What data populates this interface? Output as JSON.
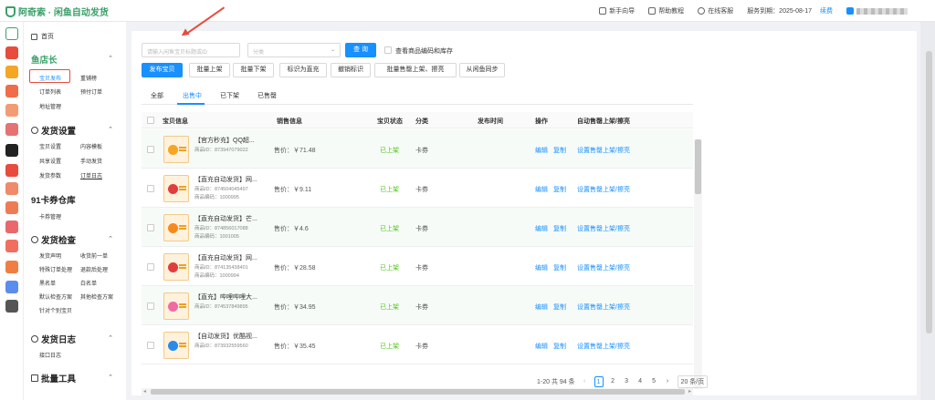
{
  "app": {
    "title": "阿奇索 · 闲鱼自动发货"
  },
  "topbar": {
    "guide": "新手向导",
    "help": "帮助教程",
    "support": "在线客服",
    "service_label": "服务到期：2025-08-17",
    "renew": "续费"
  },
  "sidebar": {
    "home": "首页",
    "sections": [
      {
        "title": "鱼店长",
        "items": [
          "宝贝发布",
          "重铺榜",
          "订单列表",
          "预付订单",
          "地址管理"
        ]
      },
      {
        "title": "发货设置",
        "items": [
          "宝贝设置",
          "内容模板",
          "共享设置",
          "手动发货",
          "发货参数",
          "订单日志"
        ]
      },
      {
        "title": "91卡券仓库",
        "items": [
          "卡券管理"
        ]
      },
      {
        "title": "发货检查",
        "items": [
          "发货声明",
          "收货前一单",
          "特殊订单处理",
          "退款后处理",
          "黑名单",
          "白名单",
          "默认检查方案",
          "其他检查方案",
          "针对个别宝贝"
        ]
      },
      {
        "title": "发货日志",
        "items": [
          "接口日志"
        ]
      },
      {
        "title": "批量工具",
        "items": []
      }
    ]
  },
  "filters": {
    "keyword_placeholder": "请输入闲鱼宝贝标题或ID",
    "category_placeholder": "分类",
    "search_button": "查 询",
    "show_code_label": "查看商品编码和库存"
  },
  "toolbar": {
    "buttons": [
      "发布宝贝",
      "批量上架",
      "批量下架",
      "标识为直充",
      "撤销标识",
      "批量售罄上架、擦亮",
      "从闲鱼同步"
    ]
  },
  "tabs": [
    "全部",
    "出售中",
    "已下架",
    "已售罄"
  ],
  "table": {
    "headers": [
      "宝贝信息",
      "销售信息",
      "宝贝状态",
      "分类",
      "发布时间",
      "操作",
      "自动售罄上架/擦亮"
    ],
    "rows": [
      {
        "title": "【官方秒充】QQ超...",
        "id": "商品ID：873947079022",
        "code": "",
        "price": "售价：￥71.48",
        "status": "已上架",
        "category": "卡券",
        "edit": "编辑",
        "copy": "复制",
        "auto": "设置售罄上架/擦亮",
        "icon_color": "#f5a623"
      },
      {
        "title": "【直充自动发货】网...",
        "id": "商品ID：874504045497",
        "code": "商品编码：1000995",
        "price": "售价：￥9.11",
        "status": "已上架",
        "category": "卡券",
        "edit": "编辑",
        "copy": "复制",
        "auto": "设置售罄上架/擦亮",
        "icon_color": "#e23d3d"
      },
      {
        "title": "【直充自动发货】芒...",
        "id": "商品ID：874856017088",
        "code": "商品编码：1001005",
        "price": "售价：￥4.6",
        "status": "已上架",
        "category": "卡券",
        "edit": "编辑",
        "copy": "复制",
        "auto": "设置售罄上架/擦亮",
        "icon_color": "#f58a1f"
      },
      {
        "title": "【直充自动发货】网...",
        "id": "商品ID：874135438401",
        "code": "商品编码：1000994",
        "price": "售价：￥28.58",
        "status": "已上架",
        "category": "卡券",
        "edit": "编辑",
        "copy": "复制",
        "auto": "设置售罄上架/擦亮",
        "icon_color": "#e23d3d"
      },
      {
        "title": "【直充】哔哩哔哩大...",
        "id": "商品ID：874537849895",
        "code": "",
        "price": "售价：￥34.95",
        "status": "已上架",
        "category": "卡券",
        "edit": "编辑",
        "copy": "复制",
        "auto": "设置售罄上架/擦亮",
        "icon_color": "#ef6ba0"
      },
      {
        "title": "【自动发货】优酷视...",
        "id": "商品ID：873932559560",
        "code": "",
        "price": "售价：￥35.45",
        "status": "已上架",
        "category": "卡券",
        "edit": "编辑",
        "copy": "复制",
        "auto": "设置售罄上架/擦亮",
        "icon_color": "#2a8ae8"
      }
    ]
  },
  "pagination": {
    "summary": "1-20 共 94 条",
    "prev": "‹",
    "pages": [
      "1",
      "2",
      "3",
      "4",
      "5"
    ],
    "next": "›",
    "page_size": "20 条/页"
  }
}
